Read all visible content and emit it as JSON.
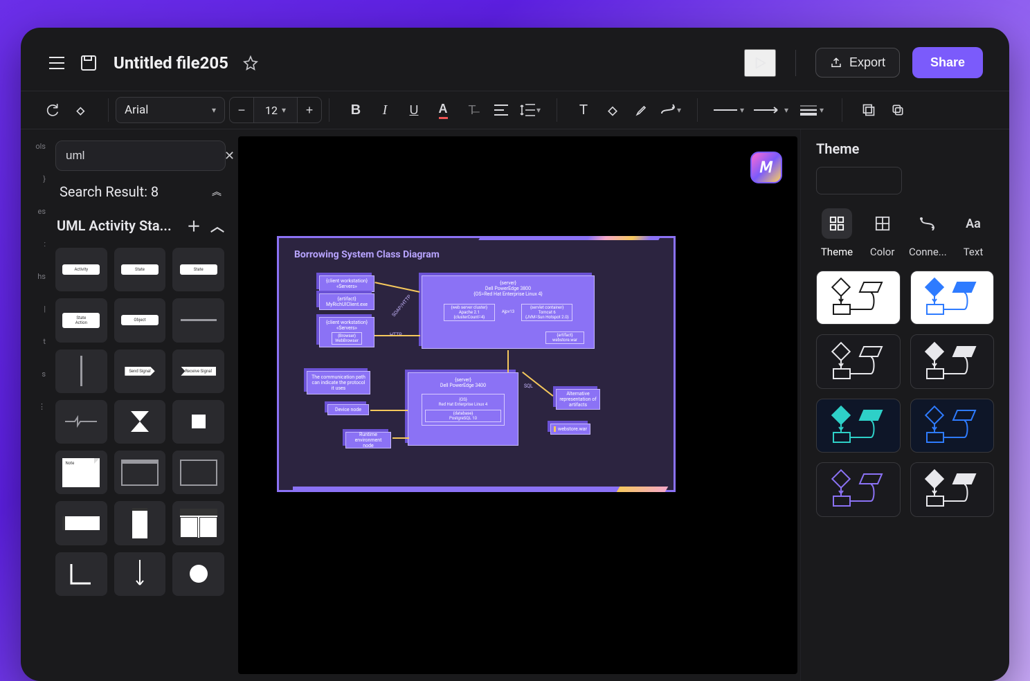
{
  "header": {
    "title": "Untitled file205",
    "export_label": "Export",
    "share_label": "Share"
  },
  "toolbar": {
    "font": "Arial",
    "font_size": "12"
  },
  "shapes_panel": {
    "search_value": "uml",
    "result_label": "Search Result: 8",
    "category_label": "UML Activity Sta...",
    "shapes": [
      {
        "label": "Activity"
      },
      {
        "label": "State"
      },
      {
        "label": "State"
      },
      {
        "label": "State\nAction"
      },
      {
        "label": "Object"
      },
      {
        "kind": "hline"
      },
      {
        "kind": "vline"
      },
      {
        "label": "Send Signal",
        "kind": "arrow-r"
      },
      {
        "label": "Receive Signal",
        "kind": "arrow-in"
      },
      {
        "kind": "zig"
      },
      {
        "kind": "hourglass"
      },
      {
        "kind": "square"
      },
      {
        "label": "Note",
        "kind": "note"
      },
      {
        "kind": "folder"
      },
      {
        "kind": "frame"
      },
      {
        "kind": "bar-sm"
      },
      {
        "kind": "bar-v"
      },
      {
        "kind": "grid4"
      },
      {
        "kind": "corner"
      },
      {
        "kind": "arrow-down"
      },
      {
        "kind": "circle"
      }
    ]
  },
  "canvas": {
    "diagram_title": "Borrowing System Class Diagram",
    "nodes": {
      "client1": {
        "stereo": "{client workstation}",
        "name": "«Servers»"
      },
      "artifact1": {
        "stereo": "{artifact}",
        "name": "MyRichUIClient.exe"
      },
      "client2": {
        "stereo": "{client workstation}",
        "name": "«Servers»"
      },
      "browser": {
        "stereo": "{Browser}",
        "name": "WebBrowser"
      },
      "server": {
        "stereo": "{server}",
        "name": "Dell PowerEdge 3800",
        "sub": "{OS=Red Hat Enterprise Linux 4}"
      },
      "web_cluster": {
        "stereo": "{web server cluster}",
        "name": "Apache 2.1",
        "sub": "{clusterCount=4}"
      },
      "ajpv13": "Ajpv13",
      "servlet": {
        "stereo": "{servlet container}",
        "name": "Tomcat 6",
        "sub": "{JVM=Sun Hotspot 2.0}"
      },
      "artifact2": {
        "stereo": "{artifact}",
        "name": "webstore.war"
      },
      "comm_note": "The communication path can indicate the protocol it uses",
      "device": "Device node",
      "server2": {
        "stereo": "{server}",
        "name": "Dell PowerEdge 3400"
      },
      "os": {
        "stereo": "{OS}",
        "name": "Red Hat Enterprise Linux 4"
      },
      "db": {
        "stereo": "{database}",
        "name": "PostgreSQL 10"
      },
      "runtime": "Runtime\nenvironment node",
      "alt": "Alternative\nrepresentation\nof artifacts",
      "webstore2": "webstore.war"
    },
    "edge_labels": {
      "soap": "SOAP/HTTP",
      "http": "HTTP",
      "sql": "SQL"
    }
  },
  "right_panel": {
    "title": "Theme",
    "tabs": [
      {
        "id": "theme",
        "label": "Theme"
      },
      {
        "id": "color",
        "label": "Color"
      },
      {
        "id": "connector",
        "label": "Conne..."
      },
      {
        "id": "text",
        "label": "Text"
      }
    ],
    "theme_colors": [
      {
        "bg": "bg-white",
        "c": "#1A1A1A"
      },
      {
        "bg": "bg-white",
        "c": "#2E7BFF",
        "fill": "#2E7BFF"
      },
      {
        "bg": "bg-dark",
        "c": "#E8E8EC"
      },
      {
        "bg": "bg-dark",
        "c": "#E8E8EC",
        "fill": "#E8E8EC"
      },
      {
        "bg": "bg-navy",
        "c": "#2ED0C8",
        "fill": "#2ED0C8"
      },
      {
        "bg": "bg-navy",
        "c": "#2E7BFF"
      },
      {
        "bg": "bg-dark",
        "c": "#8B72F5"
      },
      {
        "bg": "bg-dark",
        "c": "#E8E8EC",
        "fill": "#E8E8EC"
      }
    ]
  }
}
